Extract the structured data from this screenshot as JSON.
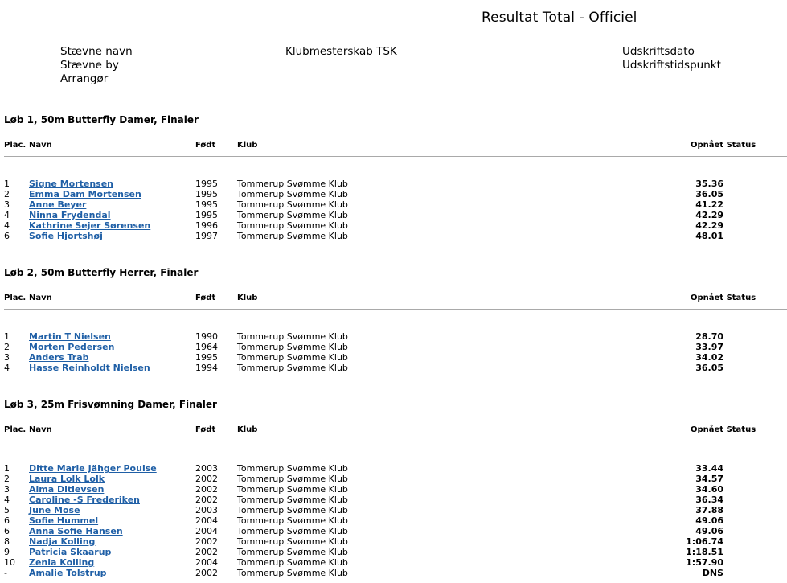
{
  "page": {
    "title": "Resultat Total - Officiel",
    "meta_left": [
      "Stævne navn",
      "Stævne by",
      "Arrangør"
    ],
    "meta_mid": "Klubmesterskab TSK",
    "meta_right": [
      "Udskriftsdato",
      "Udskriftstidspunkt"
    ]
  },
  "headers": {
    "plac": "Plac.",
    "name": "Navn",
    "born": "Født",
    "club": "Klub",
    "status": "Opnået Status"
  },
  "events": [
    {
      "title": "Løb 1, 50m Butterfly Damer, Finaler",
      "rows": [
        {
          "plac": "1",
          "name": "Signe Mortensen",
          "born": "1995",
          "club": "Tommerup Svømme Klub",
          "time": "35.36"
        },
        {
          "plac": "2",
          "name": "Emma Dam Mortensen",
          "born": "1995",
          "club": "Tommerup Svømme Klub",
          "time": "36.05"
        },
        {
          "plac": "3",
          "name": "Anne Beyer",
          "born": "1995",
          "club": "Tommerup Svømme Klub",
          "time": "41.22"
        },
        {
          "plac": "4",
          "name": "Ninna Frydendal",
          "born": "1995",
          "club": "Tommerup Svømme Klub",
          "time": "42.29"
        },
        {
          "plac": "4",
          "name": "Kathrine Sejer Sørensen",
          "born": "1996",
          "club": "Tommerup Svømme Klub",
          "time": "42.29"
        },
        {
          "plac": "6",
          "name": "Sofie Hjortshøj",
          "born": "1997",
          "club": "Tommerup Svømme Klub",
          "time": "48.01"
        }
      ]
    },
    {
      "title": "Løb 2, 50m Butterfly Herrer, Finaler",
      "rows": [
        {
          "plac": "1",
          "name": "Martin T Nielsen",
          "born": "1990",
          "club": "Tommerup Svømme Klub",
          "time": "28.70"
        },
        {
          "plac": "2",
          "name": "Morten Pedersen",
          "born": "1964",
          "club": "Tommerup Svømme Klub",
          "time": "33.97"
        },
        {
          "plac": "3",
          "name": "Anders Trab",
          "born": "1995",
          "club": "Tommerup Svømme Klub",
          "time": "34.02"
        },
        {
          "plac": "4",
          "name": "Hasse Reinholdt Nielsen",
          "born": "1994",
          "club": "Tommerup Svømme Klub",
          "time": "36.05"
        }
      ]
    },
    {
      "title": "Løb 3, 25m Frisvømning Damer, Finaler",
      "rows": [
        {
          "plac": "1",
          "name": "Ditte Marie Jähger Poulse",
          "born": "2003",
          "club": "Tommerup Svømme Klub",
          "time": "33.44"
        },
        {
          "plac": "2",
          "name": "Laura Lolk Lolk",
          "born": "2002",
          "club": "Tommerup Svømme Klub",
          "time": "34.57"
        },
        {
          "plac": "3",
          "name": "Alma Ditlevsen",
          "born": "2002",
          "club": "Tommerup Svømme Klub",
          "time": "34.60"
        },
        {
          "plac": "4",
          "name": "Caroline -S Frederiken",
          "born": "2002",
          "club": "Tommerup Svømme Klub",
          "time": "36.34"
        },
        {
          "plac": "5",
          "name": "June Mose",
          "born": "2003",
          "club": "Tommerup Svømme Klub",
          "time": "37.88"
        },
        {
          "plac": "6",
          "name": "Sofie Hummel",
          "born": "2004",
          "club": "Tommerup Svømme Klub",
          "time": "49.06"
        },
        {
          "plac": "6",
          "name": "Anna Sofie Hansen",
          "born": "2004",
          "club": "Tommerup Svømme Klub",
          "time": "49.06"
        },
        {
          "plac": "8",
          "name": "Nadja Kolling",
          "born": "2002",
          "club": "Tommerup Svømme Klub",
          "time": "1:06.74"
        },
        {
          "plac": "9",
          "name": "Patricia Skaarup",
          "born": "2002",
          "club": "Tommerup Svømme Klub",
          "time": "1:18.51"
        },
        {
          "plac": "10",
          "name": "Zenia Kolling",
          "born": "2004",
          "club": "Tommerup Svømme Klub",
          "time": "1:57.90"
        },
        {
          "plac": "-",
          "name": "Amalie Tolstrup",
          "born": "2002",
          "club": "Tommerup Svømme Klub",
          "time": "DNS"
        }
      ]
    }
  ]
}
